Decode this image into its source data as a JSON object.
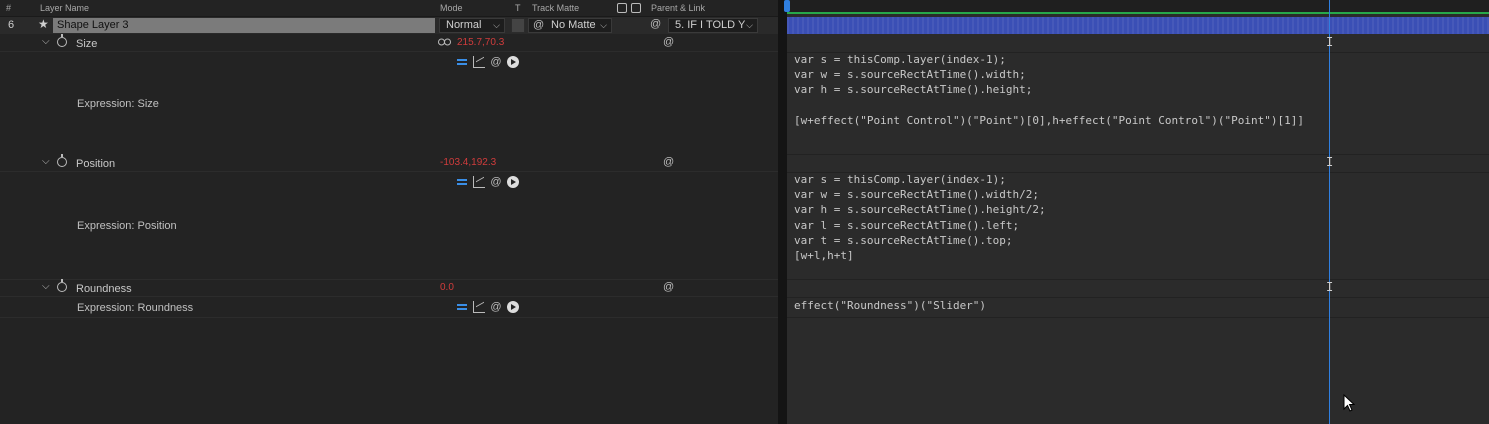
{
  "header": {
    "num": "#",
    "layer_name": "Layer Name",
    "mode": "Mode",
    "t": "T",
    "track_matte": "Track Matte",
    "parent_link": "Parent & Link"
  },
  "layer": {
    "index": "6",
    "name": "Shape Layer 3",
    "mode": "Normal",
    "track_matte": "No Matte",
    "parent": "5. IF I TOLD Y"
  },
  "properties": [
    {
      "name": "Size",
      "value": "215.7,70.3",
      "expression_label": "Expression: Size",
      "code": "var s = thisComp.layer(index-1);\nvar w = s.sourceRectAtTime().width;\nvar h = s.sourceRectAtTime().height;\n\n[w+effect(\"Point Control\")(\"Point\")[0],h+effect(\"Point Control\")(\"Point\")[1]]"
    },
    {
      "name": "Position",
      "value": "-103.4,192.3",
      "expression_label": "Expression: Position",
      "code": "var s = thisComp.layer(index-1);\nvar w = s.sourceRectAtTime().width/2;\nvar h = s.sourceRectAtTime().height/2;\nvar l = s.sourceRectAtTime().left;\nvar t = s.sourceRectAtTime().top;\n[w+l,h+t]"
    },
    {
      "name": "Roundness",
      "value": "0.0",
      "expression_label": "Expression: Roundness",
      "code": "effect(\"Roundness\")(\"Slider\")"
    }
  ],
  "colors": {
    "value_red": "#d03c3c",
    "accent_blue": "#2f7fe0",
    "layer_bar": "#3a4fb5",
    "work_area_green": "#27a84a"
  },
  "icons": {
    "star": "star-icon",
    "stopwatch": "stopwatch-icon",
    "link": "link-icon",
    "pickwhip": "pickwhip-spiral-icon",
    "expr_enable": "expression-enable-icon",
    "graph": "graph-icon",
    "play": "expression-language-menu-icon"
  }
}
